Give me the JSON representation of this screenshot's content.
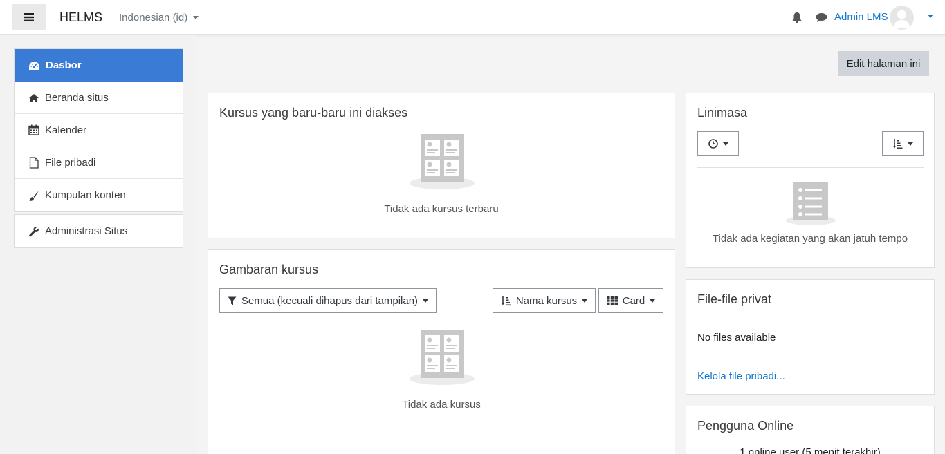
{
  "navbar": {
    "brand": "HELMS",
    "language": "Indonesian (id)",
    "user_name": "Admin LMS"
  },
  "leftnav": {
    "items": [
      {
        "label": "Dasbor",
        "icon": "dashboard-icon"
      },
      {
        "label": "Beranda situs",
        "icon": "home-icon"
      },
      {
        "label": "Kalender",
        "icon": "calendar-icon"
      },
      {
        "label": "File pribadi",
        "icon": "file-icon"
      },
      {
        "label": "Kumpulan konten",
        "icon": "brush-icon"
      }
    ],
    "admin_item": {
      "label": "Administrasi Situs",
      "icon": "wrench-icon"
    }
  },
  "main": {
    "edit_button": "Edit halaman ini",
    "recent_courses": {
      "title": "Kursus yang baru-baru ini diakses",
      "empty_text": "Tidak ada kursus terbaru"
    },
    "course_overview": {
      "title": "Gambaran kursus",
      "filter_label": "Semua (kecuali dihapus dari tampilan)",
      "sort_label": "Nama kursus",
      "view_label": "Card",
      "empty_text": "Tidak ada kursus"
    }
  },
  "sidebar": {
    "timeline": {
      "title": "Linimasa",
      "empty_text": "Tidak ada kegiatan yang akan jatuh tempo"
    },
    "private_files": {
      "title": "File-file privat",
      "no_files": "No files available",
      "manage_link": "Kelola file pribadi..."
    },
    "online_users": {
      "title": "Pengguna Online",
      "summary": "1 online user (5 menit terakhir)"
    }
  },
  "colors": {
    "accent": "#3a7bd5",
    "link": "#1177d1"
  }
}
